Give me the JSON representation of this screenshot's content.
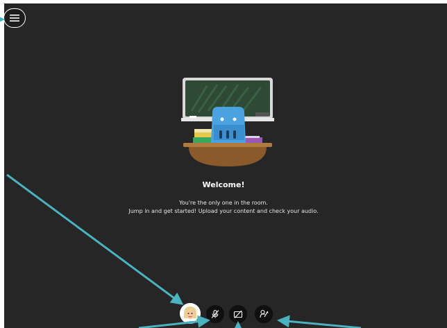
{
  "welcome": {
    "title": "Welcome!",
    "line1": "You're the only one in the room.",
    "line2": "Jump in and get started! Upload your content and check your audio."
  },
  "controls": {
    "menu_icon": "hamburger-menu-icon",
    "avatar": "user-avatar",
    "microphone_icon": "microphone-off-icon",
    "camera_icon": "camera-off-icon",
    "share_icon": "share-content-icon"
  },
  "colors": {
    "background": "#262626",
    "annotation_arrow": "#4bb3c0",
    "status_online": "#3bb273"
  }
}
